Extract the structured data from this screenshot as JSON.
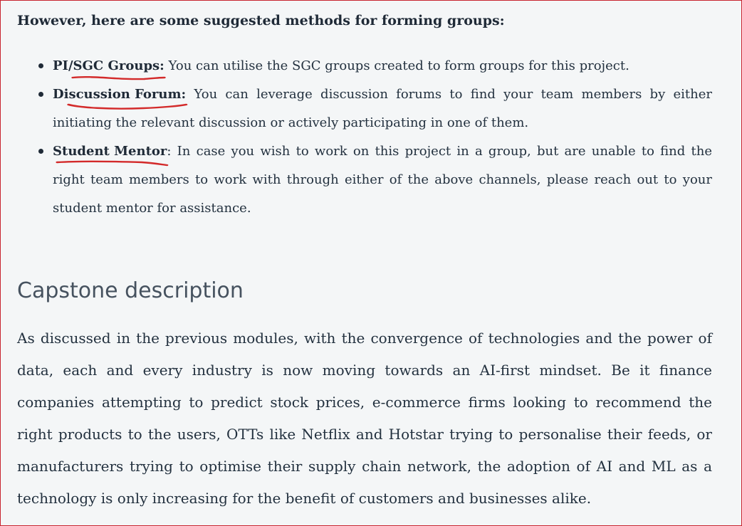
{
  "section": {
    "intro": "However, here are some suggested methods for forming groups:",
    "methods": [
      {
        "term": "PI/SGC Groups:",
        "text": " You can utilise the SGC groups created to form groups for this project."
      },
      {
        "term": "Discussion Forum:",
        "text": " You can leverage discussion forums to find your team members by either initiating the relevant discussion or actively participating in one of them."
      },
      {
        "term": "Student Mentor",
        "text": ": In case you wish to work on this project in a group, but are unable to find the right team members to work with through either of the above channels, please reach out to your student mentor for assistance."
      }
    ],
    "annotation_color": "#d32a2a"
  },
  "capstone": {
    "heading": "Capstone description",
    "paragraph": "As discussed in the previous modules, with the convergence of technologies and the power of data, each and every industry is now moving towards an AI-first mindset. Be it finance companies attempting to predict stock prices, e-commerce firms looking to recommend the right products to the users, OTTs like Netflix and Hotstar trying to personalise their feeds, or manufacturers trying to optimise their supply chain network, the adoption of AI and ML as a technology is only increasing for the benefit of customers and businesses alike."
  },
  "theme": {
    "background": "#f4f6f7",
    "border": "#c8242f",
    "text": "#1f2a37",
    "heading": "#46525f"
  }
}
